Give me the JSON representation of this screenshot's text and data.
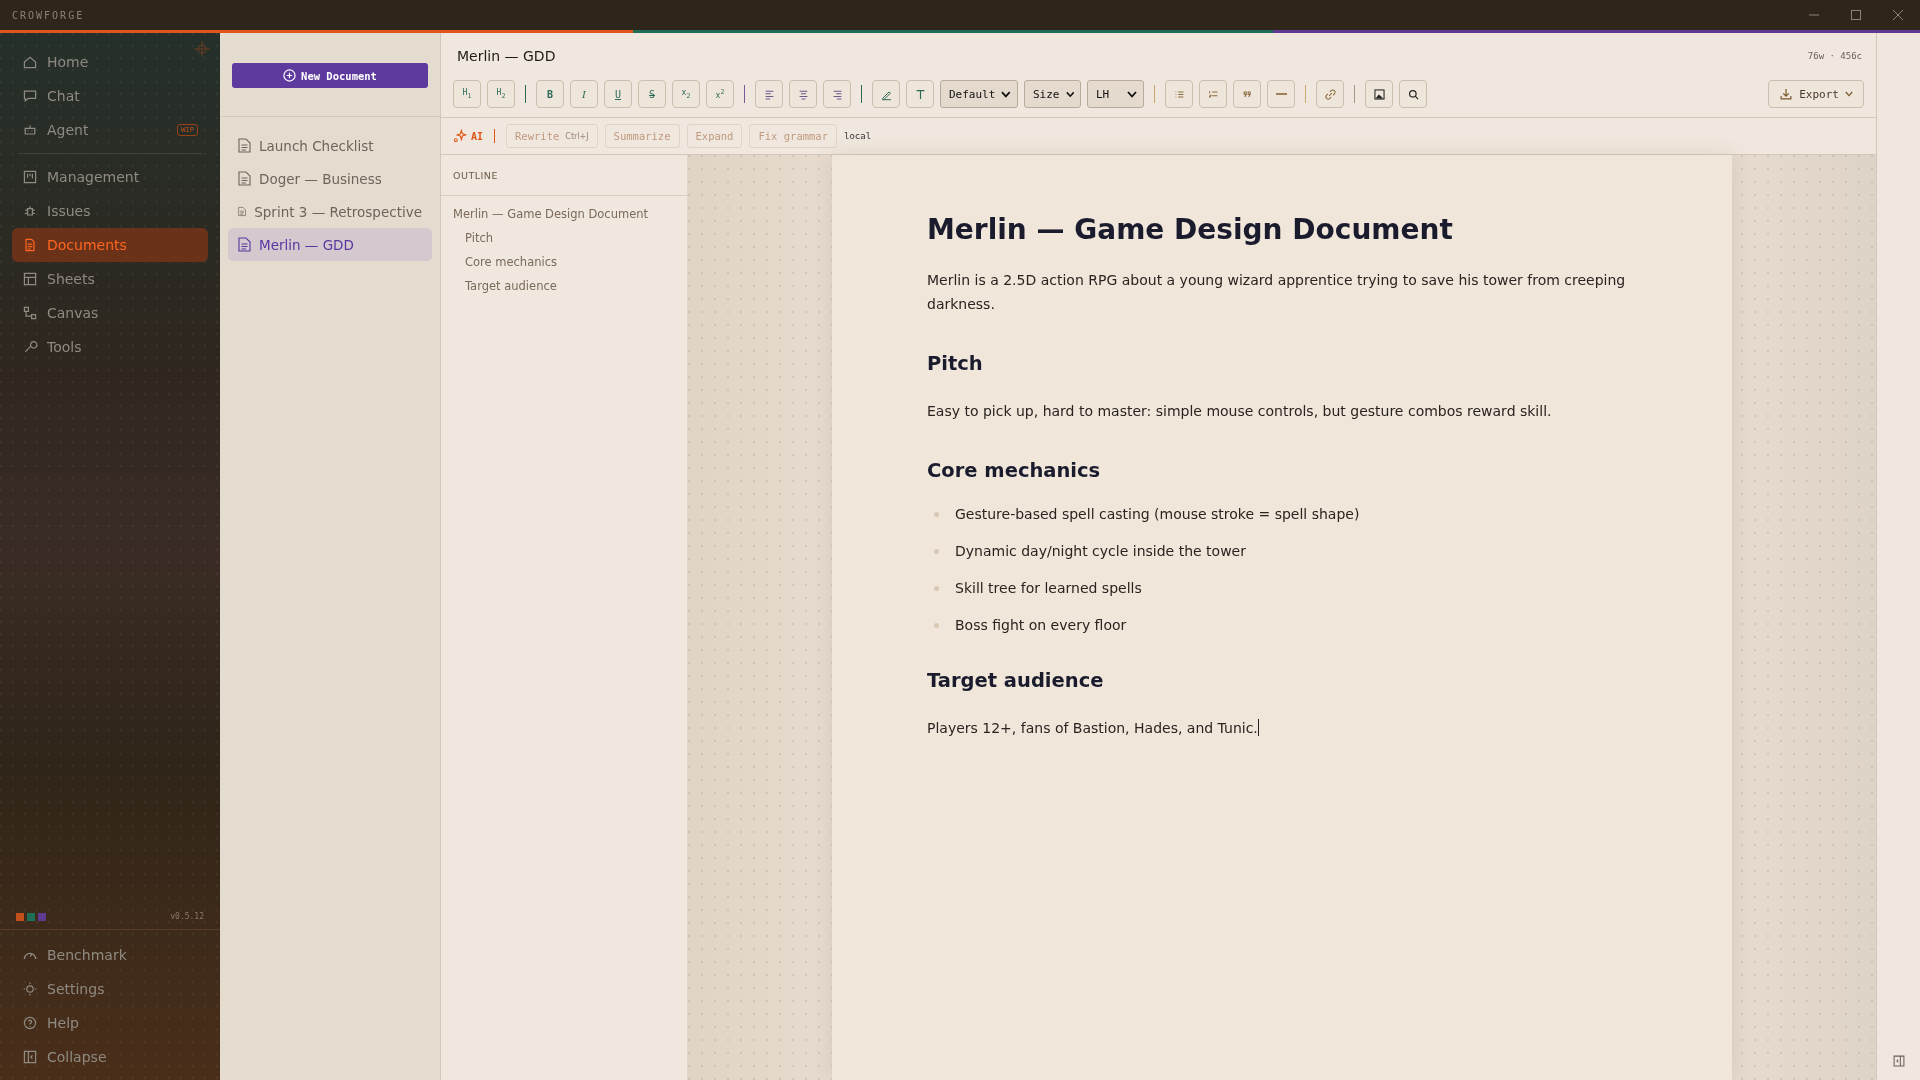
{
  "window": {
    "title": "CROWFORGE"
  },
  "sidebar": {
    "main_items": [
      {
        "label": "Home",
        "selected": false
      },
      {
        "label": "Chat",
        "selected": false
      },
      {
        "label": "Agent",
        "selected": false,
        "badge": "WIP"
      }
    ],
    "work_items": [
      {
        "label": "Management",
        "selected": false
      },
      {
        "label": "Issues",
        "selected": false
      },
      {
        "label": "Documents",
        "selected": true
      },
      {
        "label": "Sheets",
        "selected": false
      },
      {
        "label": "Canvas",
        "selected": false
      },
      {
        "label": "Tools",
        "selected": false
      }
    ],
    "swatches": [
      {
        "color": "#c4501c"
      },
      {
        "color": "#1f6e58"
      },
      {
        "color": "#5e3a92"
      }
    ],
    "version": "v0.5.12",
    "footer_items": [
      {
        "label": "Benchmark"
      },
      {
        "label": "Settings"
      },
      {
        "label": "Help"
      },
      {
        "label": "Collapse"
      }
    ]
  },
  "documents": {
    "new_button": "New Document",
    "items": [
      {
        "title": "Launch Checklist",
        "selected": false
      },
      {
        "title": "Doger — Business",
        "selected": false
      },
      {
        "title": "Sprint 3 — Retrospective",
        "selected": false
      },
      {
        "title": "Merlin — GDD",
        "selected": true
      }
    ]
  },
  "editor": {
    "title": "Merlin — GDD",
    "stats": "76w · 456c",
    "format_buttons": [
      "H$_{1}$",
      "H$_{2}$",
      "B",
      "I",
      "U",
      "S",
      "x$_{2}$",
      "x$^{2}$"
    ],
    "selects": [
      "Default",
      "Size",
      "LH"
    ],
    "export_button": "Export",
    "ai": {
      "label": "AI",
      "actions": [
        {
          "label": "Rewrite",
          "shortcut": "Ctrl+J"
        },
        {
          "label": "Summarize"
        },
        {
          "label": "Expand"
        },
        {
          "label": "Fix grammar"
        }
      ],
      "mode": "local"
    }
  },
  "outline": {
    "heading": "OUTLINE",
    "items": [
      {
        "title": "Merlin — Game Design Document",
        "children": [
          {
            "title": "Pitch"
          },
          {
            "title": "Core mechanics"
          },
          {
            "title": "Target audience"
          }
        ]
      }
    ]
  },
  "document": {
    "blocks": [
      {
        "kind": "h1",
        "text": "Merlin — Game Design Document"
      },
      {
        "kind": "p",
        "text": "Merlin is a 2.5D action RPG about a young wizard apprentice trying to save his tower from creeping darkness."
      },
      {
        "kind": "h2",
        "text": "Pitch"
      },
      {
        "kind": "p",
        "text": "Easy to pick up, hard to master: simple mouse controls, but gesture combos reward skill."
      },
      {
        "kind": "h2",
        "text": "Core mechanics"
      },
      {
        "kind": "ul",
        "items": [
          "Gesture-based spell casting (mouse stroke = spell shape)",
          "Dynamic day/night cycle inside the tower",
          "Skill tree for learned spells",
          "Boss fight on every floor"
        ]
      },
      {
        "kind": "h2",
        "text": "Target audience"
      },
      {
        "kind": "p",
        "text": "Players 12+, fans of Bastion, Hades, and Tunic.",
        "caret": true
      }
    ]
  }
}
